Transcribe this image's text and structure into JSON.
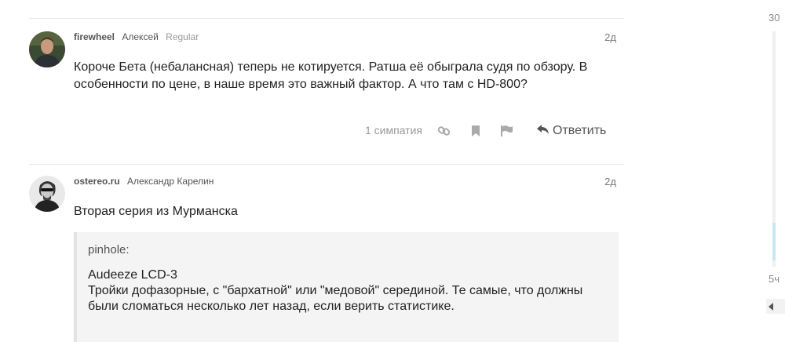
{
  "posts": [
    {
      "username": "firewheel",
      "name": "Алексей",
      "user_title": "Regular",
      "date": "2д",
      "text": "Короче Бета (небалансная) теперь не котируется. Ратша её обыграла судя по обзору. В особенности по цене, в наше время это важный фактор. А что там с HD-800?",
      "likes": "1 симпатия",
      "reply_label": "Ответить"
    },
    {
      "username": "ostereo.ru",
      "name": "Александр Карелин",
      "date": "2д",
      "text": "Вторая серия из Мурманска",
      "quote": {
        "author": "pinhole:",
        "title": "Audeeze LCD-3",
        "text": "Тройки дофазорные, с \"бархатной\" или \"медовой\" серединой. Те самые, что должны были сломаться несколько лет назад, если верить статистике."
      }
    }
  ],
  "timeline": {
    "top": "30",
    "bottom": "5ч"
  },
  "icons": [
    "link-icon",
    "bookmark-icon",
    "flag-icon",
    "reply-icon",
    "chevron-left-icon"
  ],
  "colors": {
    "accent_light": "#c7e8f3",
    "muted": "#999999"
  }
}
